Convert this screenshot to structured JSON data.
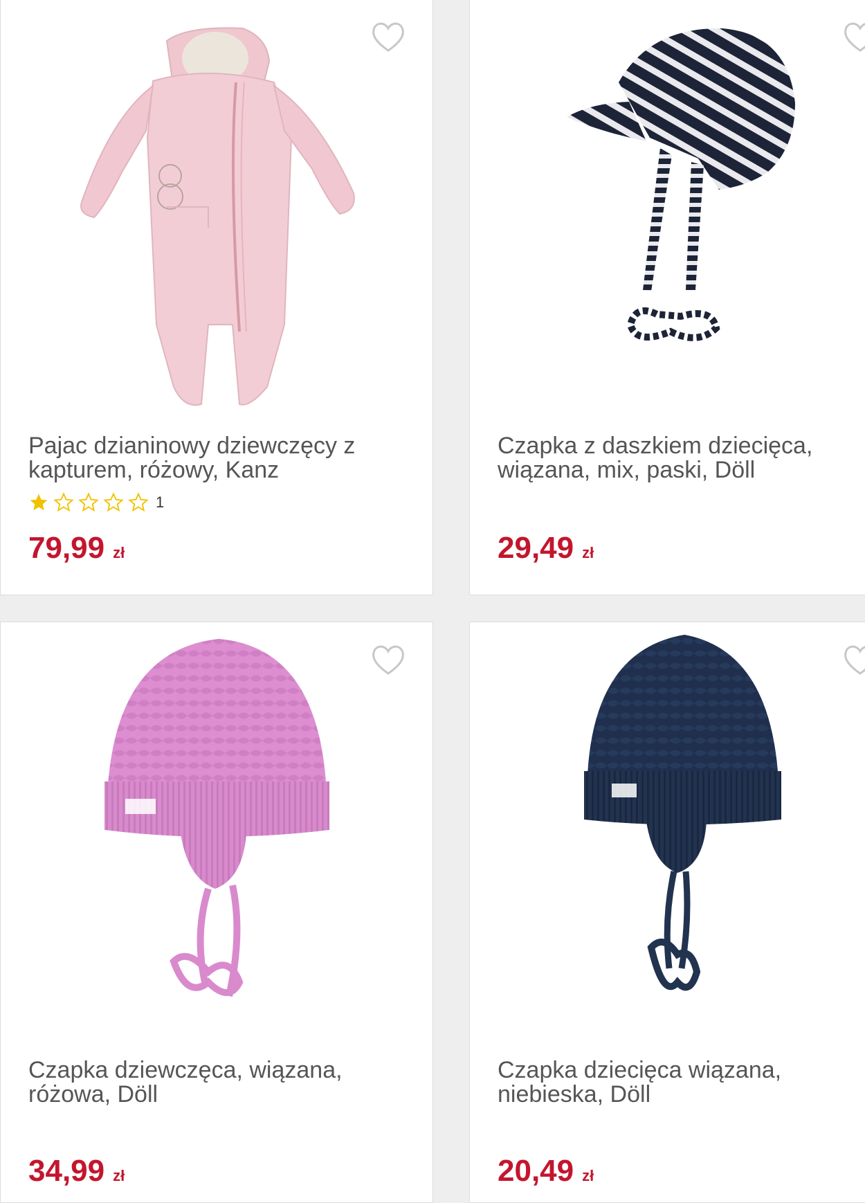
{
  "products": [
    {
      "title": "Pajac dzianinowy dziewczęcy z kapturem, różowy, Kanz",
      "rating_count": "1",
      "price": "79,99",
      "currency": "zł",
      "image_icon": "pink-snowsuit"
    },
    {
      "title": "Czapka z daszkiem dziecięca, wiązana, mix, paski, Döll",
      "price": "29,49",
      "currency": "zł",
      "image_icon": "striped-cap"
    },
    {
      "title": "Czapka dziewczęca, wiązana, różowa, Döll",
      "price": "34,99",
      "currency": "zł",
      "image_icon": "pink-knit-hat"
    },
    {
      "title": "Czapka dziecięca wiązana, niebieska, Döll",
      "price": "20,49",
      "currency": "zł",
      "image_icon": "navy-knit-hat"
    }
  ],
  "rating": {
    "filled": 1,
    "max": 5
  },
  "colors": {
    "price": "#c3162e",
    "star": "#f2c200",
    "favorite_outline": "#c8c8c8"
  }
}
